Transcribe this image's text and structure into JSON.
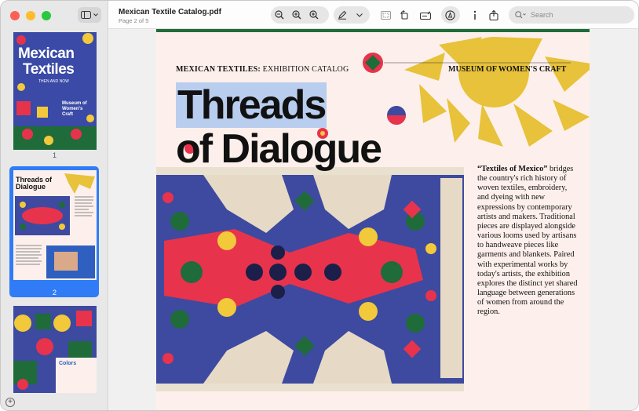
{
  "document": {
    "title": "Mexican Textile Catalog.pdf",
    "page_indicator": "Page 2 of 5"
  },
  "search": {
    "placeholder": "Search"
  },
  "thumbnails": [
    {
      "page": "1",
      "title_line1": "Mexican",
      "title_line2": "Textiles",
      "subtitle": "THEN AND NOW",
      "side_text": "Museum of Women's Craft"
    },
    {
      "page": "2",
      "mini_title": "Threads of Dialogue"
    },
    {
      "page": "",
      "mini_label": "Colors"
    }
  ],
  "page": {
    "header_bold": "MEXICAN TEXTILES:",
    "header_rest": " EXHIBITION CATALOG",
    "header_right": "MUSEUM OF WOMEN'S CRAFT",
    "title_line1": "Threads",
    "title_line2": "of Dialogue",
    "body_bold": "“Textiles of Mexico”",
    "body_text": "bridges the country's rich history of woven textiles, embroidery, and dyeing with new expressions by contemporary artists and makers. Traditional pieces are displayed alongside various looms used by artisans to handweave pieces like garments and blankets. Paired with experimental works by today's artists, the exhibition explores the distinct yet shared language between generations of women from around the region."
  },
  "colors": {
    "accent": "#2f7cf6",
    "sun": "#e7c23a",
    "rug_blue": "#3d4aa0",
    "rug_red": "#e8334c",
    "rug_green": "#1f6b3a"
  }
}
